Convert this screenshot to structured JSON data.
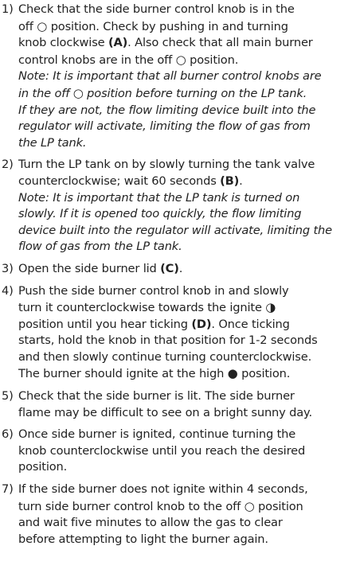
{
  "colors": {
    "text": "#222222",
    "background": "#ffffff"
  },
  "symbols": {
    "off": "○",
    "ignite": "◑",
    "high": "●"
  },
  "steps": [
    {
      "number": "1)",
      "lines": [
        [
          {
            "t": "Check that the side burner control knob is in the"
          }
        ],
        [
          {
            "t": "off "
          },
          {
            "sym": "off"
          },
          {
            "t": " position. Check by pushing in and turning"
          }
        ],
        [
          {
            "t": "knob clockwise "
          },
          {
            "t": "(A)",
            "b": true
          },
          {
            "t": ". Also check that all main burner"
          }
        ],
        [
          {
            "t": "control knobs are in the off "
          },
          {
            "sym": "off"
          },
          {
            "t": " position."
          }
        ],
        [
          {
            "t": "Note: It is important that all burner control knobs are",
            "i": true
          }
        ],
        [
          {
            "t": "in the off ",
            "i": true
          },
          {
            "sym": "off"
          },
          {
            "t": " position before turning on the LP tank.",
            "i": true
          }
        ],
        [
          {
            "t": "If they are not, the flow limiting device built into the",
            "i": true
          }
        ],
        [
          {
            "t": "regulator will activate, limiting the flow of gas from",
            "i": true
          }
        ],
        [
          {
            "t": "the LP tank.",
            "i": true
          }
        ]
      ]
    },
    {
      "number": "2)",
      "lines": [
        [
          {
            "t": "Turn the LP tank on by slowly turning the tank valve"
          }
        ],
        [
          {
            "t": "counterclockwise; wait 60 seconds "
          },
          {
            "t": "(B)",
            "b": true
          },
          {
            "t": "."
          }
        ],
        [
          {
            "t": "Note: It is important that the LP tank is turned on",
            "i": true
          }
        ],
        [
          {
            "t": "slowly. If it is opened too quickly, the flow limiting",
            "i": true
          }
        ],
        [
          {
            "t": "device built into the regulator will activate, limiting the",
            "i": true
          }
        ],
        [
          {
            "t": "flow of gas from the LP tank.",
            "i": true
          }
        ]
      ]
    },
    {
      "number": "3)",
      "lines": [
        [
          {
            "t": "Open the side burner lid "
          },
          {
            "t": "(C)",
            "b": true
          },
          {
            "t": "."
          }
        ]
      ]
    },
    {
      "number": "4)",
      "lines": [
        [
          {
            "t": "Push the side burner control knob in and slowly"
          }
        ],
        [
          {
            "t": "turn it counterclockwise towards the ignite "
          },
          {
            "sym": "ignite"
          }
        ],
        [
          {
            "t": "position until you hear ticking "
          },
          {
            "t": "(D)",
            "b": true
          },
          {
            "t": ". Once ticking"
          }
        ],
        [
          {
            "t": "starts, hold the knob in that position for 1-2 seconds"
          }
        ],
        [
          {
            "t": "and then slowly continue turning counterclockwise."
          }
        ],
        [
          {
            "t": "The burner should ignite at the high "
          },
          {
            "sym": "high"
          },
          {
            "t": " position."
          }
        ]
      ]
    },
    {
      "number": "5)",
      "lines": [
        [
          {
            "t": "Check that the side burner is lit. The side burner"
          }
        ],
        [
          {
            "t": "flame may be difficult to see on a bright sunny day."
          }
        ]
      ]
    },
    {
      "number": "6)",
      "lines": [
        [
          {
            "t": "Once side burner is ignited, continue turning the"
          }
        ],
        [
          {
            "t": "knob counterclockwise until you reach the desired"
          }
        ],
        [
          {
            "t": "position."
          }
        ]
      ]
    },
    {
      "number": "7)",
      "lines": [
        [
          {
            "t": "If the side burner does not ignite within 4 seconds,"
          }
        ],
        [
          {
            "t": "turn side burner control knob to the off "
          },
          {
            "sym": "off"
          },
          {
            "t": " position"
          }
        ],
        [
          {
            "t": "and wait five minutes to allow the gas to clear"
          }
        ],
        [
          {
            "t": "before attempting to light the burner again."
          }
        ]
      ]
    }
  ]
}
